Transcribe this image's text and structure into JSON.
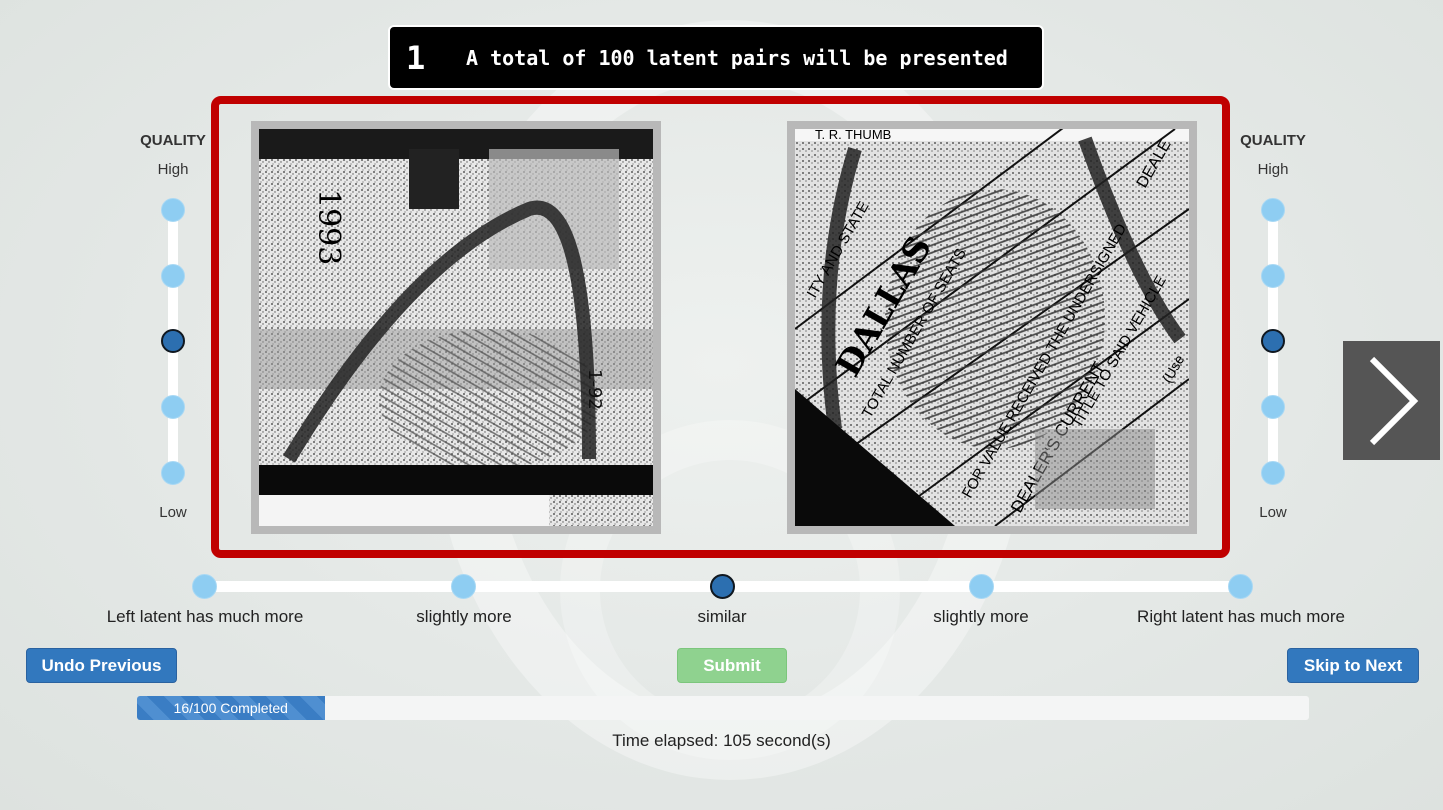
{
  "banner": {
    "number": "1",
    "text": "A total of 100 latent pairs will be presented"
  },
  "quality_left": {
    "title": "QUALITY",
    "high_label": "High",
    "low_label": "Low",
    "levels": 5,
    "selected_index": 2
  },
  "quality_right": {
    "title": "QUALITY",
    "high_label": "High",
    "low_label": "Low",
    "levels": 5,
    "selected_index": 2
  },
  "left_latent": {
    "printed_text": [
      "1993",
      "1-92"
    ]
  },
  "right_latent": {
    "printed_text": [
      "T. R. THUMB",
      "DALLAS",
      "TOTAL NUMBER OF SEATS",
      "FOR VALUE RECEIVED THE UNDERSIGNED",
      "DEALER'S CURRENT",
      "ITY AND STATE",
      "DEALE",
      "TITLE TO SAID VEHICLE",
      "(Use"
    ]
  },
  "comparison": {
    "labels": [
      "Left latent has much more",
      "slightly more",
      "similar",
      "slightly more",
      "Right latent has much more"
    ],
    "selected_index": 2
  },
  "buttons": {
    "undo": "Undo Previous",
    "submit": "Submit",
    "skip": "Skip to Next"
  },
  "progress": {
    "completed": 16,
    "total": 100,
    "label": "16/100 Completed"
  },
  "time_elapsed": "Time elapsed: 105 second(s)",
  "colors": {
    "frame_red": "#c00000",
    "button_blue": "#3278be",
    "submit_green": "#8fd28f",
    "dot_light": "#8ecdf2",
    "dot_selected": "#2c6fb0"
  }
}
